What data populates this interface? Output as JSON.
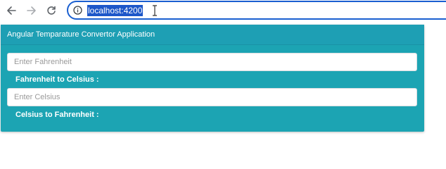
{
  "browser": {
    "nav_icons": [
      "back-arrow-icon",
      "forward-arrow-icon",
      "reload-icon"
    ],
    "site_info_icon": "info-icon",
    "url": "localhost:4200",
    "url_highlight_color": "#1d57c9",
    "address_border_color": "#1a5fd0"
  },
  "app": {
    "title": "Angular Temparature Convertor Application",
    "accent_color": "#1ca4b3",
    "fahrenheit_input": {
      "placeholder": "Enter Fahrenheit",
      "value": ""
    },
    "fahrenheit_to_celsius_label": "Fahrenheit to Celsius :",
    "celsius_input": {
      "placeholder": "Enter Celsius",
      "value": ""
    },
    "celsius_to_fahrenheit_label": "Celsius to Fahrenheit :"
  }
}
